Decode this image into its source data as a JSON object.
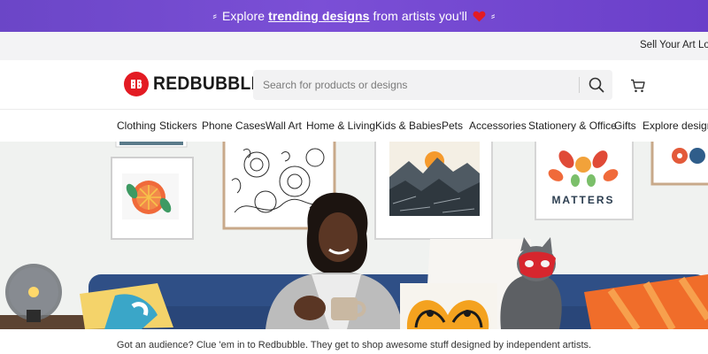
{
  "promo": {
    "prefix": "Explore",
    "link": "trending designs",
    "suffix": "from artists you'll",
    "heart_icon": "heart-icon",
    "heart_color": "#e31b23",
    "background": "#6b46c7"
  },
  "utility": {
    "sell_label": "Sell Your Art",
    "login_label": "Lo"
  },
  "header": {
    "logo_text": "REDBUBBLE",
    "brand_color": "#e31b23",
    "search_placeholder": "Search for products or designs",
    "search_icon": "search-icon",
    "cart_icon": "cart-icon"
  },
  "categories": [
    "Clothing",
    "Stickers",
    "Phone Cases",
    "Wall Art",
    "Home & Living",
    "Kids & Babies",
    "Pets",
    "Accessories",
    "Stationery & Office",
    "Gifts",
    "Explore designs"
  ],
  "hero": {
    "poster_text": "MATTERS"
  },
  "caption": "Got an audience? Clue 'em in to Redbubble. They get to shop awesome stuff designed by independent artists."
}
